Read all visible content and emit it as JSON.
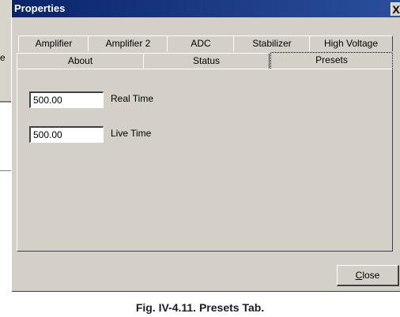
{
  "background": {
    "partial_letter": "e"
  },
  "dialog": {
    "title": "Properties",
    "close_glyph": "X",
    "tabs_row1": [
      "Amplifier",
      "Amplifier 2",
      "ADC",
      "Stabilizer",
      "High Voltage"
    ],
    "tabs_row2": [
      "About",
      "Status",
      "Presets"
    ],
    "active_tab": "Presets",
    "fields": [
      {
        "label": "Real Time",
        "value": "500.00"
      },
      {
        "label": "Live Time",
        "value": "500.00"
      }
    ],
    "close_button": {
      "label_accel": "C",
      "label_rest": "lose"
    }
  },
  "caption": "Fig. IV-4.11.  Presets Tab.",
  "colors": {
    "titlebar_start": "#0a246a",
    "titlebar_end": "#2b4f9c",
    "face": "#d4d0c8"
  }
}
